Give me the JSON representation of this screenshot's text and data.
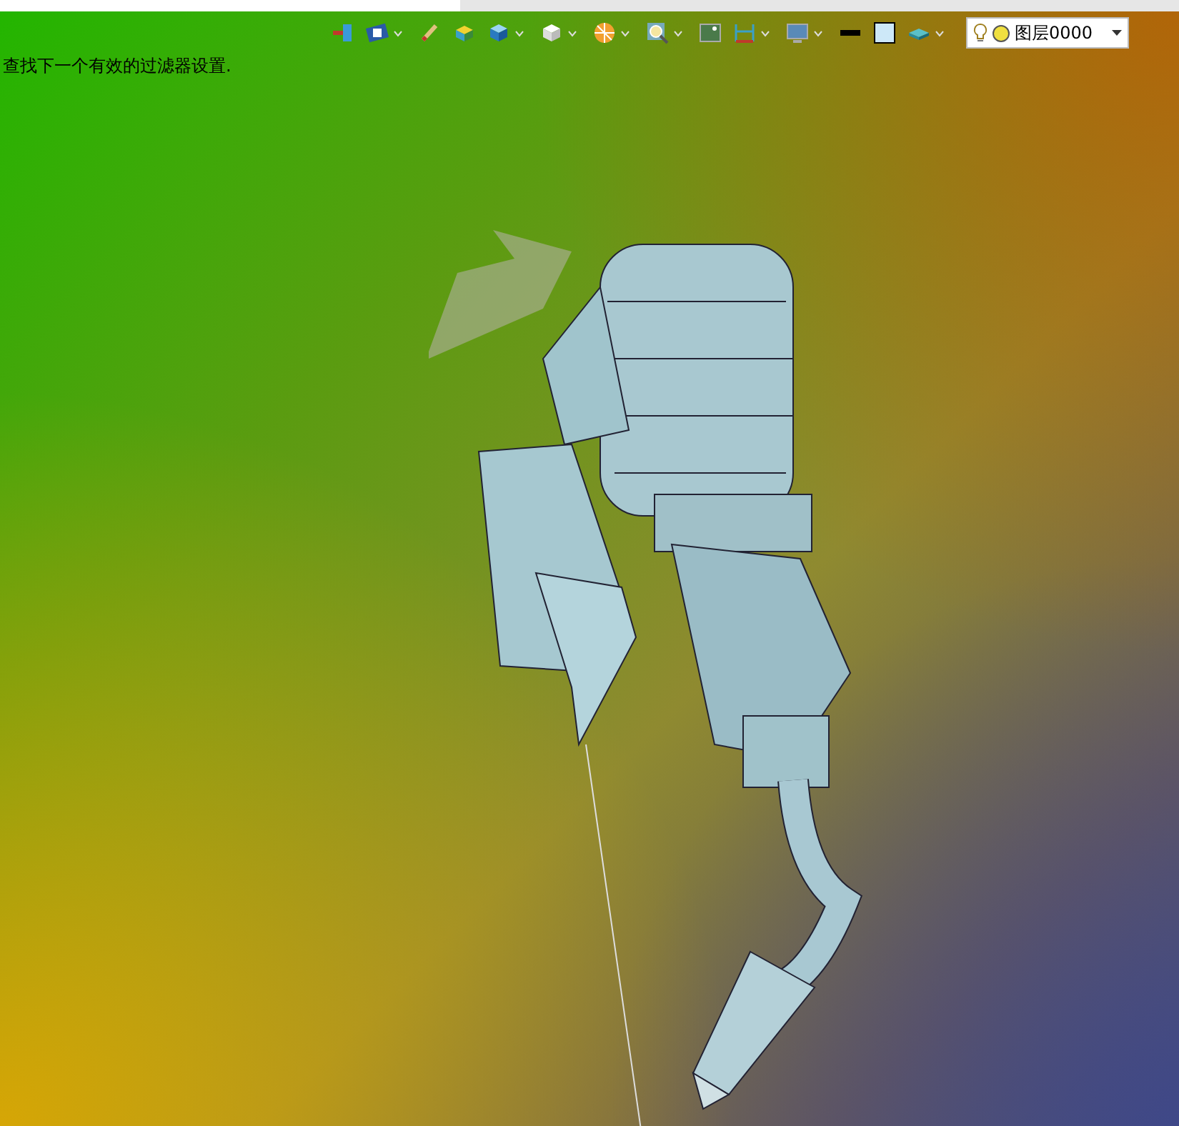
{
  "status_message": "查找下一个有效的过滤器设置.",
  "layer_selector": {
    "value": "图层0000"
  }
}
